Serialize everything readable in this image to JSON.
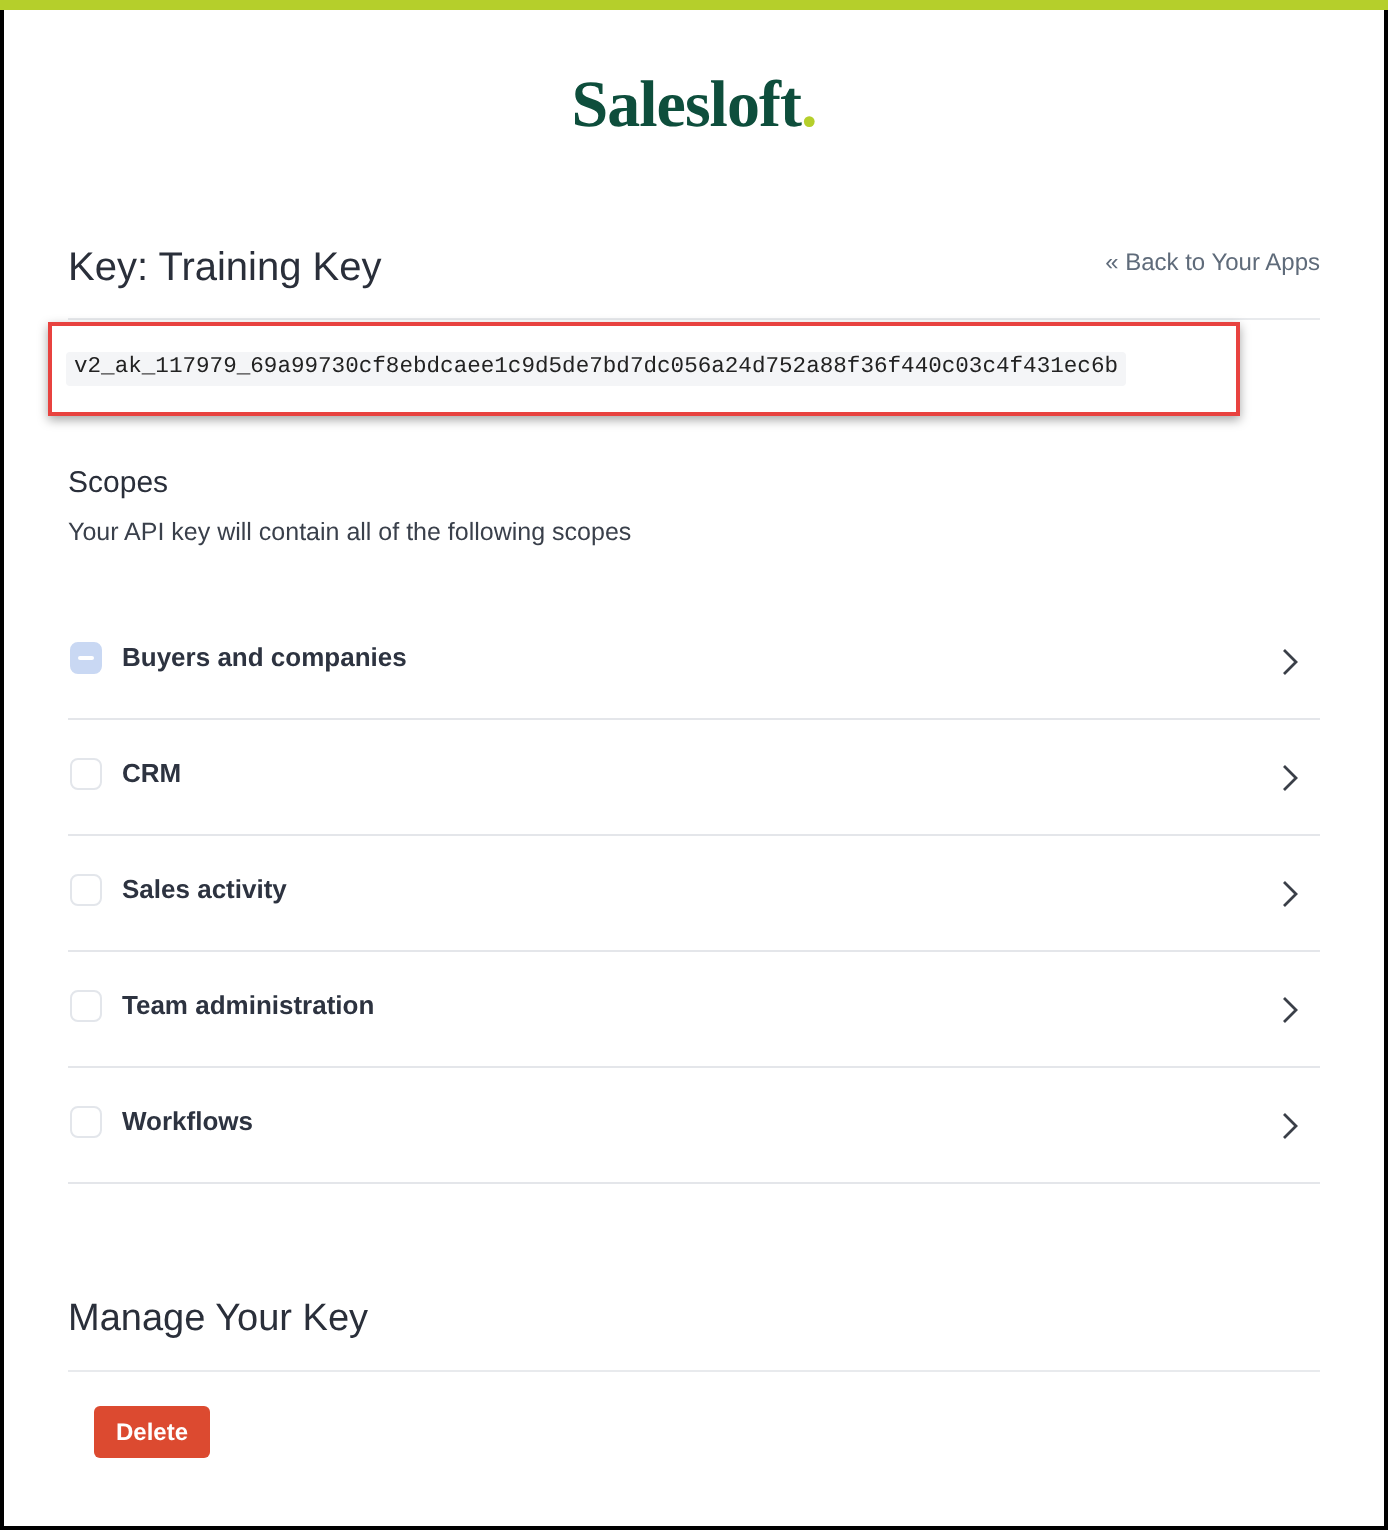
{
  "logo": {
    "text": "Salesloft",
    "dot": "."
  },
  "header": {
    "title": "Key: Training Key",
    "back_link": "« Back to Your Apps"
  },
  "api_key": {
    "value": "v2_ak_117979_69a99730cf8ebdcaee1c9d5de7bd7dc056a24d752a88f36f440c03c4f431ec6b",
    "highlighted": true
  },
  "scopes": {
    "title": "Scopes",
    "description": "Your API key will contain all of the following scopes",
    "items": [
      {
        "label": "Buyers and companies",
        "checked": false,
        "indeterminate": true
      },
      {
        "label": "CRM",
        "checked": false,
        "indeterminate": false
      },
      {
        "label": "Sales activity",
        "checked": false,
        "indeterminate": false
      },
      {
        "label": "Team administration",
        "checked": false,
        "indeterminate": false
      },
      {
        "label": "Workflows",
        "checked": false,
        "indeterminate": false
      }
    ]
  },
  "manage": {
    "title": "Manage Your Key",
    "buttons": [
      "Delete"
    ]
  }
}
